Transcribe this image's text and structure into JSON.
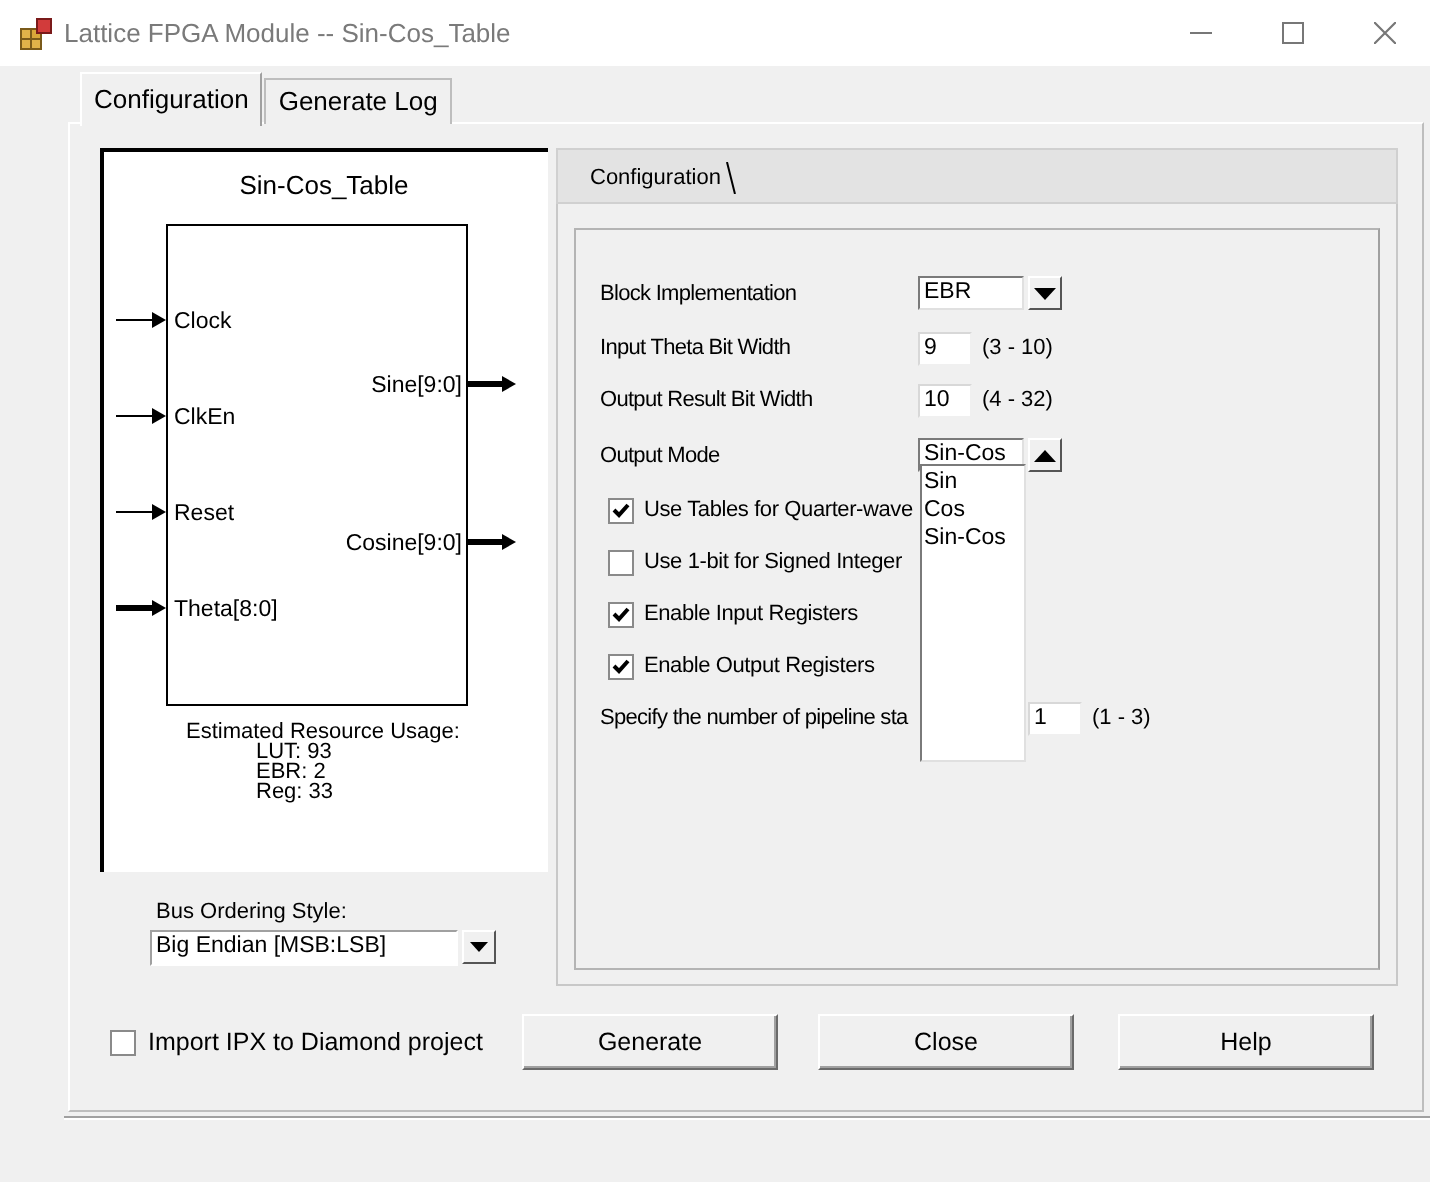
{
  "window": {
    "title": "Lattice FPGA Module -- Sin-Cos_Table"
  },
  "tabs": [
    {
      "label": "Configuration",
      "selected": true
    },
    {
      "label": "Generate Log",
      "selected": false
    }
  ],
  "diagram": {
    "title": "Sin-Cos_Table",
    "inputs": [
      {
        "label": "Clock",
        "bus": false
      },
      {
        "label": "ClkEn",
        "bus": false
      },
      {
        "label": "Reset",
        "bus": false
      },
      {
        "label": "Theta[8:0]",
        "bus": true
      }
    ],
    "outputs": [
      {
        "label": "Sine[9:0]",
        "bus": true
      },
      {
        "label": "Cosine[9:0]",
        "bus": true
      }
    ],
    "resource_usage": [
      "Estimated Resource Usage:",
      "LUT: 93",
      "EBR: 2",
      "Reg: 33"
    ]
  },
  "bus_ordering": {
    "label": "Bus Ordering Style:",
    "value": "Big Endian [MSB:LSB]"
  },
  "config_tab": {
    "label": "Configuration"
  },
  "settings": [
    {
      "kind": "select",
      "label": "Block Implementation",
      "value": "EBR",
      "expanded": false
    },
    {
      "kind": "number",
      "label": "Input Theta Bit Width",
      "value": "9",
      "range": "(3 - 10)"
    },
    {
      "kind": "number",
      "label": "Output Result Bit Width",
      "value": "10",
      "range": "(4 - 32)"
    },
    {
      "kind": "select",
      "label": "Output Mode",
      "value": "Sin-Cos",
      "expanded": true,
      "options": [
        "Sin",
        "Cos",
        "Sin-Cos"
      ]
    },
    {
      "kind": "checkbox",
      "label": "Use Tables for Quarter-wave",
      "checked": true
    },
    {
      "kind": "checkbox",
      "label": "Use 1-bit for Signed Integer",
      "checked": false
    },
    {
      "kind": "checkbox",
      "label": "Enable Input Registers",
      "checked": true
    },
    {
      "kind": "checkbox",
      "label": "Enable Output Registers",
      "checked": true
    },
    {
      "kind": "number",
      "label": "Specify the number of pipeline sta",
      "value": "1",
      "range": "(1 - 3)"
    }
  ],
  "import_ipx": {
    "label": "Import IPX to Diamond project",
    "checked": false
  },
  "buttons": [
    "Generate",
    "Close",
    "Help"
  ]
}
